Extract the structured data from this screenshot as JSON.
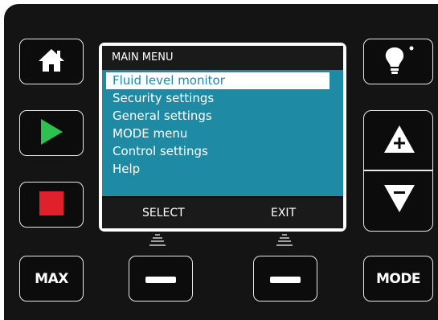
{
  "screen": {
    "title": "MAIN MENU",
    "menu_items": [
      "Fluid level monitor",
      "Security settings",
      "General settings",
      "MODE menu",
      "Control settings",
      "Help"
    ],
    "selected_index": 0,
    "softkeys": {
      "left": "SELECT",
      "right": "EXIT"
    }
  },
  "buttons": {
    "max_label": "MAX",
    "mode_label": "MODE"
  },
  "icons": {
    "home": "home-icon",
    "play": "play-icon",
    "stop": "stop-icon",
    "light": "lightbulb-icon",
    "increase": "plus-triangle-icon",
    "decrease": "minus-triangle-icon",
    "softkey_left": "dash-icon",
    "softkey_right": "dash-icon"
  },
  "colors": {
    "menu_background": "#1e8aa4",
    "play_green": "#2ec050",
    "stop_red": "#e0202a",
    "panel": "#141414"
  }
}
